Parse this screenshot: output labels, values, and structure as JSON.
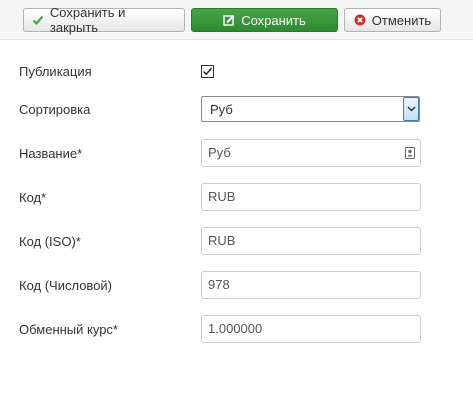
{
  "toolbar": {
    "save_close_label": "Сохранить и закрыть",
    "save_label": "Сохранить",
    "cancel_label": "Отменить"
  },
  "form": {
    "published": {
      "label": "Публикация",
      "checked": true
    },
    "ordering": {
      "label": "Сортировка",
      "value": "Руб"
    },
    "name": {
      "label": "Название*",
      "value": "Руб"
    },
    "code": {
      "label": "Код*",
      "value": "RUB"
    },
    "code_iso": {
      "label": "Код (ISO)*",
      "value": "RUB"
    },
    "code_numeric": {
      "label": "Код (Числовой)",
      "value": "978"
    },
    "rate": {
      "label": "Обменный курс*",
      "value": "1.000000"
    }
  },
  "colors": {
    "accent_green": "#46a546",
    "cancel_red": "#bd362f"
  }
}
